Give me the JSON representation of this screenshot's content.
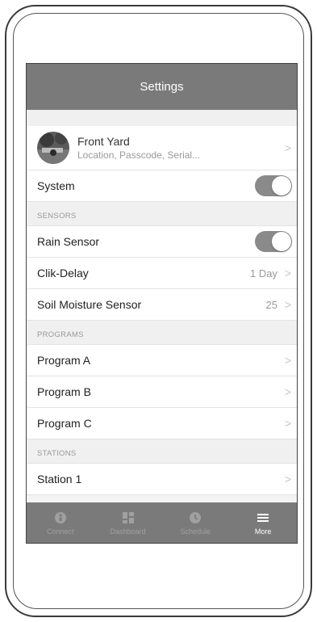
{
  "header": {
    "title": "Settings"
  },
  "profile": {
    "title": "Front Yard",
    "subtitle": "Location, Passcode, Serial...",
    "chevron": ">"
  },
  "system": {
    "label": "System",
    "toggle_on": true
  },
  "sensors": {
    "section_title": "SENSORS",
    "rain_sensor": {
      "label": "Rain Sensor",
      "toggle_on": true
    },
    "clik_delay": {
      "label": "Clik-Delay",
      "value": "1 Day",
      "chevron": ">"
    },
    "soil_moisture": {
      "label": "Soil Moisture Sensor",
      "value": "25",
      "chevron": ">"
    }
  },
  "programs": {
    "section_title": "PROGRAMS",
    "items": [
      {
        "label": "Program A",
        "chevron": ">"
      },
      {
        "label": "Program B",
        "chevron": ">"
      },
      {
        "label": "Program C",
        "chevron": ">"
      }
    ]
  },
  "stations": {
    "section_title": "STATIONS",
    "items": [
      {
        "label": "Station 1",
        "chevron": ">"
      }
    ]
  },
  "tabbar": {
    "tabs": [
      {
        "label": "Connect",
        "icon": "connect-icon"
      },
      {
        "label": "Dashboard",
        "icon": "dashboard-icon"
      },
      {
        "label": "Schedule",
        "icon": "schedule-icon"
      },
      {
        "label": "More",
        "icon": "menu-icon",
        "active": true
      }
    ]
  },
  "colors": {
    "header_bg": "#7a7a7a",
    "toggle_on": "#8a8a8a",
    "tab_active": "#ffffff",
    "tab_inactive": "#a0a0a0"
  }
}
